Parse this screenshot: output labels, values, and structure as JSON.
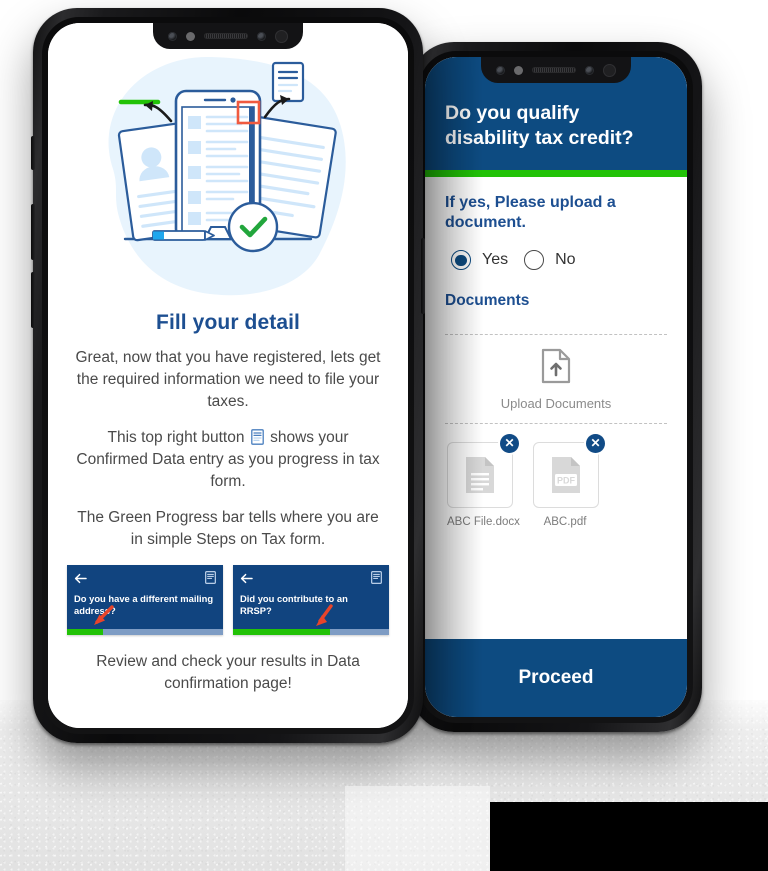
{
  "scene": {
    "background_color": "#ffffff",
    "ground_color": "#e9e9e9",
    "brand_blue": "#0d4b81",
    "heading_blue": "#1d4f91",
    "progress_green": "#22c207",
    "arrow_red": "#e8442a"
  },
  "left_phone": {
    "title": "Fill your detail",
    "paragraphs": [
      "Great, now that you have registered, lets get the required information we need to file your taxes.",
      "This top right button  shows your Confirmed Data entry as you progress in tax form.",
      "The Green Progress bar tells where you are in simple Steps on Tax form."
    ],
    "paragraph2_prefix": "This top right button",
    "paragraph2_suffix": "shows your Confirmed Data entry as you progress in tax form.",
    "footer": "Review and check your results in Data confirmation page!",
    "illustration": {
      "name": "form-filling-illustration",
      "blob_color": "#e8f4fd",
      "line_color": "#2b5c9b",
      "accent_color": "#cfe6fa",
      "check_color": "#22a63c",
      "highlight_color": "#f05a3f",
      "green_line_color": "#22c207"
    },
    "preview_cards": [
      {
        "question": "Do you have a different mailing address?",
        "progress_percent": 23,
        "back_icon": "back-arrow-icon",
        "doc_icon": "document-icon",
        "arrow_icon": "red-arrow-icon"
      },
      {
        "question": "Did you contribute to an RRSP?",
        "progress_percent": 62,
        "back_icon": "back-arrow-icon",
        "doc_icon": "document-icon",
        "arrow_icon": "red-arrow-icon"
      }
    ]
  },
  "right_phone": {
    "question": "Do you qualify disability tax credit?",
    "progress_percent": 100,
    "subtitle": "If yes, Please upload a document.",
    "radio_options": [
      {
        "label": "Yes",
        "selected": true
      },
      {
        "label": "No",
        "selected": false
      }
    ],
    "documents_heading": "Documents",
    "dropzone": {
      "label": "Upload Documents",
      "icon": "file-upload-icon"
    },
    "files": [
      {
        "name": "ABC File.docx",
        "type": "docx",
        "remove_icon": "close-circle-icon"
      },
      {
        "name": "ABC.pdf",
        "type": "pdf",
        "remove_icon": "close-circle-icon"
      }
    ],
    "proceed_label": "Proceed"
  }
}
